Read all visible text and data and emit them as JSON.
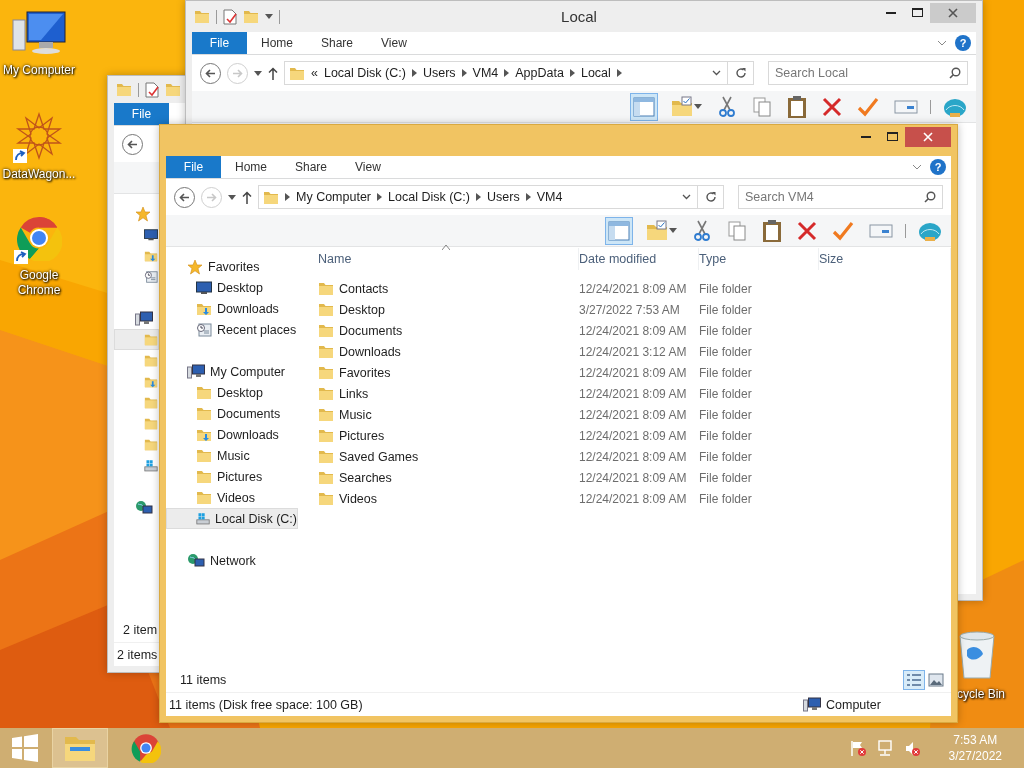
{
  "desktop": {
    "icons": [
      {
        "label": "My Computer",
        "kind": "computer",
        "shortcut": false
      },
      {
        "label": "DataWagon...",
        "kind": "app",
        "shortcut": true
      },
      {
        "label": "Google Chrome",
        "kind": "chrome",
        "shortcut": true
      },
      {
        "label": "cycle Bin",
        "kind": "recycle",
        "shortcut": false
      }
    ]
  },
  "back_window": {
    "active": false,
    "tab": "File",
    "nav": [
      {
        "kind": "star",
        "selected": false,
        "children": [
          {
            "kind": "monitor",
            "selected": false
          },
          {
            "kind": "downloads",
            "selected": false
          },
          {
            "kind": "recent",
            "selected": false
          }
        ]
      },
      {
        "kind": "computer",
        "selected": false,
        "children": [
          {
            "kind": "folder",
            "selected": true
          },
          {
            "kind": "folder",
            "selected": false
          },
          {
            "kind": "downloads",
            "selected": false
          },
          {
            "kind": "folder",
            "selected": false
          },
          {
            "kind": "folder",
            "selected": false
          },
          {
            "kind": "folder",
            "selected": false
          },
          {
            "kind": "disk",
            "selected": false
          }
        ]
      },
      {
        "kind": "network",
        "selected": false
      }
    ],
    "item_count": "2 item",
    "status": "2 items"
  },
  "local_window": {
    "title": "Local",
    "active": false,
    "tabs": [
      {
        "label": "File",
        "kind": "file"
      },
      {
        "label": "Home",
        "kind": "tab"
      },
      {
        "label": "Share",
        "kind": "tab"
      },
      {
        "label": "View",
        "kind": "tab"
      }
    ],
    "help": "?",
    "address": {
      "overflow": "«",
      "crumbs": [
        "Local Disk (C:)",
        "Users",
        "VM4",
        "AppData",
        "Local"
      ],
      "trailing_separator": true
    },
    "search": {
      "placeholder": "Search Local"
    }
  },
  "front_window": {
    "active": true,
    "tabs": [
      {
        "label": "File",
        "kind": "file"
      },
      {
        "label": "Home",
        "kind": "tab"
      },
      {
        "label": "Share",
        "kind": "tab"
      },
      {
        "label": "View",
        "kind": "tab"
      }
    ],
    "help": "?",
    "address": {
      "crumbs": [
        "My Computer",
        "Local Disk (C:)",
        "Users",
        "VM4"
      ],
      "trailing_separator": false
    },
    "search": {
      "placeholder": "Search VM4"
    },
    "nav": [
      {
        "kind": "star",
        "label": "Favorites",
        "selected": false,
        "children": [
          {
            "kind": "monitor",
            "label": "Desktop",
            "selected": false
          },
          {
            "kind": "downloads",
            "label": "Downloads",
            "selected": false
          },
          {
            "kind": "recent",
            "label": "Recent places",
            "selected": false
          }
        ]
      },
      {
        "kind": "computer",
        "label": "My Computer",
        "selected": false,
        "children": [
          {
            "kind": "folder",
            "label": "Desktop",
            "selected": false
          },
          {
            "kind": "folder",
            "label": "Documents",
            "selected": false
          },
          {
            "kind": "downloads",
            "label": "Downloads",
            "selected": false
          },
          {
            "kind": "folder",
            "label": "Music",
            "selected": false
          },
          {
            "kind": "folder",
            "label": "Pictures",
            "selected": false
          },
          {
            "kind": "folder",
            "label": "Videos",
            "selected": false
          },
          {
            "kind": "disk",
            "label": "Local Disk (C:)",
            "selected": true
          }
        ]
      },
      {
        "kind": "network",
        "label": "Network",
        "selected": false
      }
    ],
    "columns": [
      {
        "label": "Name",
        "sorted": true
      },
      {
        "label": "Date modified",
        "sorted": false
      },
      {
        "label": "Type",
        "sorted": false
      },
      {
        "label": "Size",
        "sorted": false
      }
    ],
    "rows": [
      {
        "name": "Contacts",
        "date": "12/24/2021 8:09 AM",
        "type": "File folder"
      },
      {
        "name": "Desktop",
        "date": "3/27/2022 7:53 AM",
        "type": "File folder"
      },
      {
        "name": "Documents",
        "date": "12/24/2021 8:09 AM",
        "type": "File folder"
      },
      {
        "name": "Downloads",
        "date": "12/24/2021 3:12 AM",
        "type": "File folder"
      },
      {
        "name": "Favorites",
        "date": "12/24/2021 8:09 AM",
        "type": "File folder"
      },
      {
        "name": "Links",
        "date": "12/24/2021 8:09 AM",
        "type": "File folder"
      },
      {
        "name": "Music",
        "date": "12/24/2021 8:09 AM",
        "type": "File folder"
      },
      {
        "name": "Pictures",
        "date": "12/24/2021 8:09 AM",
        "type": "File folder"
      },
      {
        "name": "Saved Games",
        "date": "12/24/2021 8:09 AM",
        "type": "File folder"
      },
      {
        "name": "Searches",
        "date": "12/24/2021 8:09 AM",
        "type": "File folder"
      },
      {
        "name": "Videos",
        "date": "12/24/2021 8:09 AM",
        "type": "File folder"
      }
    ],
    "item_count": "11 items",
    "views": [
      {
        "kind": "details",
        "selected": true
      },
      {
        "kind": "large_icons",
        "selected": false
      }
    ],
    "status": {
      "text": "11 items (Disk free space: 100 GB)",
      "location": "Computer"
    }
  },
  "taskbar": {
    "apps": [
      {
        "kind": "explorer",
        "selected": true
      },
      {
        "kind": "chrome",
        "selected": false
      }
    ],
    "tray": [
      {
        "kind": "flag",
        "alert": true
      },
      {
        "kind": "network",
        "alert": false
      },
      {
        "kind": "volume",
        "alert": true
      }
    ],
    "time": "7:53 AM",
    "date": "3/27/2022"
  }
}
